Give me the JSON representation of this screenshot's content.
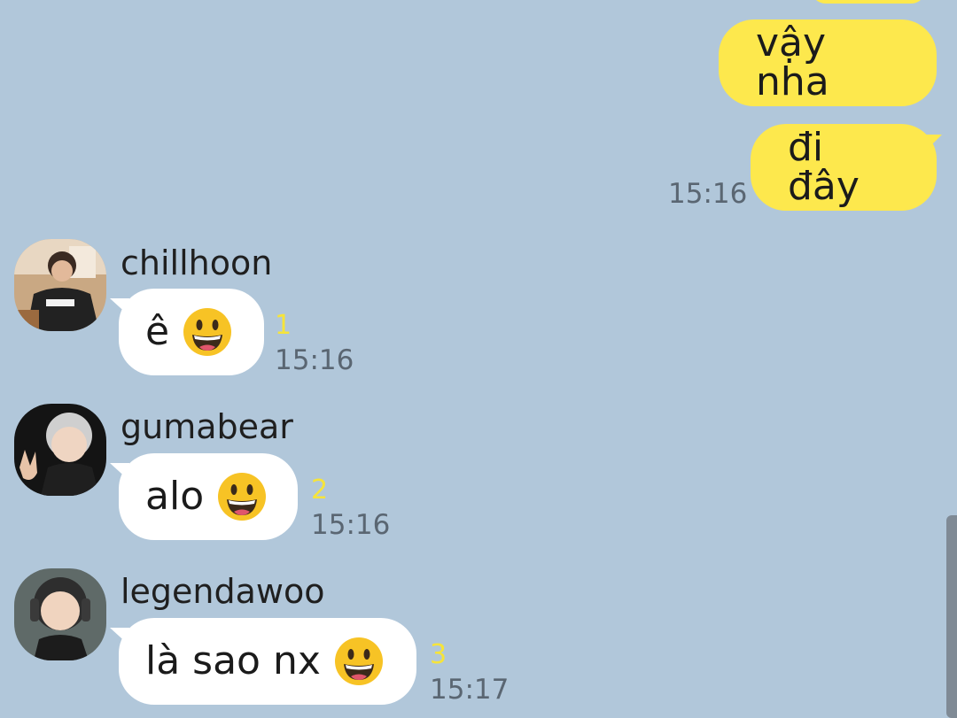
{
  "outgoing": [
    {
      "text": "vậy nha"
    },
    {
      "text": "đi đây",
      "time": "15:16"
    }
  ],
  "incoming": [
    {
      "sender": "chillhoon",
      "text": "ê",
      "emoji": "grinning-face-emoji",
      "unread": "1",
      "time": "15:16"
    },
    {
      "sender": "gumabear",
      "text": "alo",
      "emoji": "grinning-face-emoji",
      "unread": "2",
      "time": "15:16"
    },
    {
      "sender": "legendawoo",
      "text": "là sao nx",
      "emoji": "grinning-face-emoji",
      "unread": "3",
      "time": "15:17"
    }
  ],
  "colors": {
    "background": "#b1c7da",
    "outgoing_bubble": "#fde84d",
    "incoming_bubble": "#ffffff",
    "unread_count": "#f6e43a",
    "timestamp": "#5a6672"
  }
}
